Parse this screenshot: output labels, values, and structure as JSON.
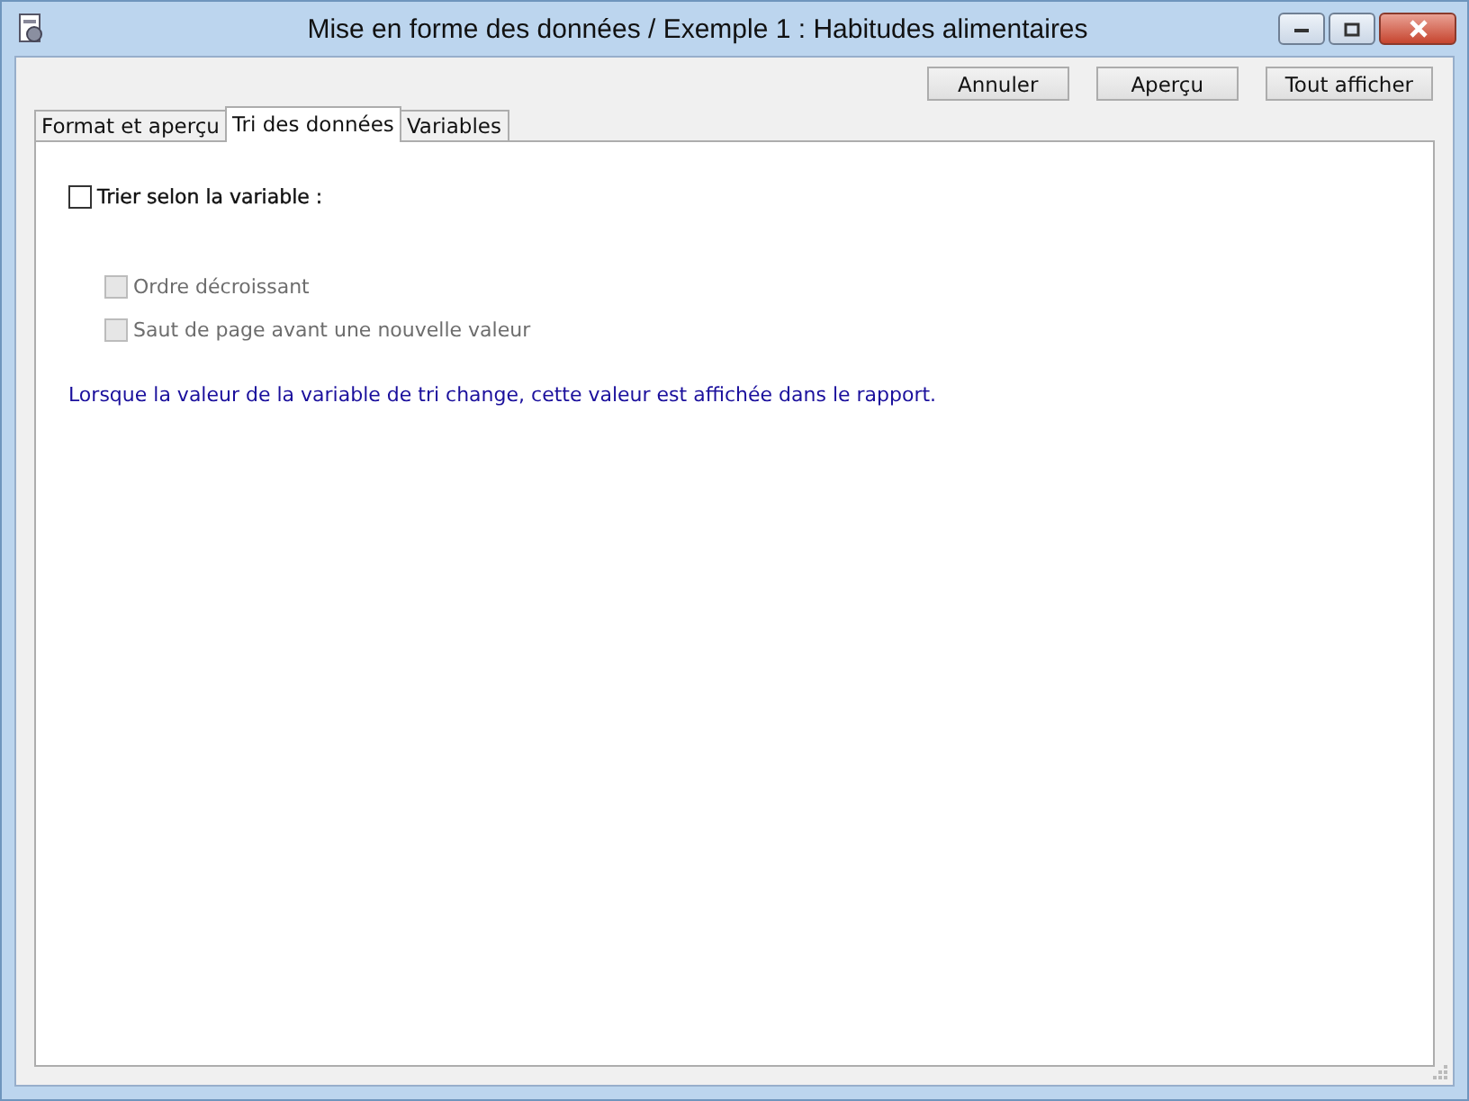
{
  "window": {
    "title": "Mise en forme des données / Exemple 1 : Habitudes alimentaires"
  },
  "buttons": [
    "Annuler",
    "Aperçu",
    "Tout afficher"
  ],
  "tabs": [
    {
      "label": "Format et aperçu",
      "selected": false
    },
    {
      "label": "Tri des données",
      "selected": true
    },
    {
      "label": "Variables",
      "selected": false
    }
  ],
  "sort": {
    "label": "Trier selon la variable :",
    "checked": false,
    "disabled": false
  },
  "options": [
    {
      "label": "Ordre décroissant",
      "checked": false,
      "disabled": true
    },
    {
      "label": "Saut de page avant une nouvelle valeur",
      "checked": false,
      "disabled": true
    }
  ],
  "note": "Lorsque la valeur de la variable de tri change, cette valeur est affichée dans le rapport."
}
